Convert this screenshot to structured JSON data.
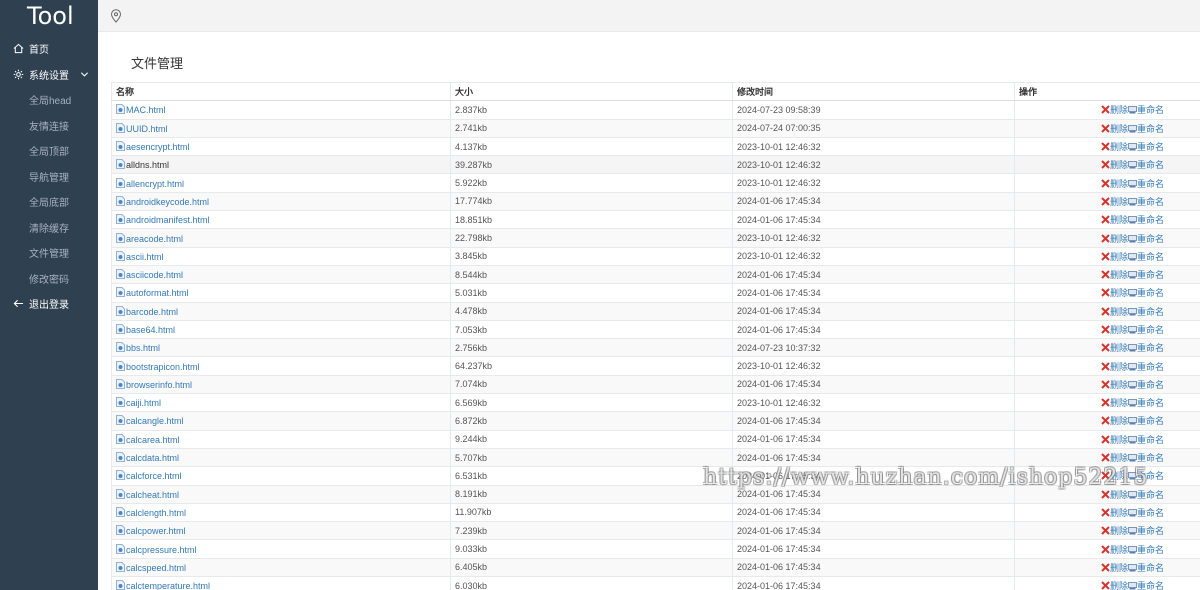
{
  "app": {
    "logo": "Tool"
  },
  "sidebar": {
    "home": "首页",
    "system_settings": "系统设置",
    "sub_items": [
      "全局head",
      "友情连接",
      "全局顶部",
      "导航管理",
      "全局底部",
      "清除缓存",
      "文件管理",
      "修改密码"
    ],
    "logout": "退出登录"
  },
  "page": {
    "title": "文件管理"
  },
  "table": {
    "headers": {
      "name": "名称",
      "size": "大小",
      "modified": "修改时间",
      "actions": "操作"
    },
    "rows": [
      {
        "name": "MAC.html",
        "size": "2.837kb",
        "modified": "2024-07-23 09:58:39"
      },
      {
        "name": "UUID.html",
        "size": "2.741kb",
        "modified": "2024-07-24 07:00:35"
      },
      {
        "name": "aesencrypt.html",
        "size": "4.137kb",
        "modified": "2023-10-01 12:46:32"
      },
      {
        "name": "alldns.html",
        "size": "39.287kb",
        "modified": "2023-10-01 12:46:32"
      },
      {
        "name": "allencrypt.html",
        "size": "5.922kb",
        "modified": "2023-10-01 12:46:32"
      },
      {
        "name": "androidkeycode.html",
        "size": "17.774kb",
        "modified": "2024-01-06 17:45:34"
      },
      {
        "name": "androidmanifest.html",
        "size": "18.851kb",
        "modified": "2024-01-06 17:45:34"
      },
      {
        "name": "areacode.html",
        "size": "22.798kb",
        "modified": "2023-10-01 12:46:32"
      },
      {
        "name": "ascii.html",
        "size": "3.845kb",
        "modified": "2023-10-01 12:46:32"
      },
      {
        "name": "asciicode.html",
        "size": "8.544kb",
        "modified": "2024-01-06 17:45:34"
      },
      {
        "name": "autoformat.html",
        "size": "5.031kb",
        "modified": "2024-01-06 17:45:34"
      },
      {
        "name": "barcode.html",
        "size": "4.478kb",
        "modified": "2024-01-06 17:45:34"
      },
      {
        "name": "base64.html",
        "size": "7.053kb",
        "modified": "2024-01-06 17:45:34"
      },
      {
        "name": "bbs.html",
        "size": "2.756kb",
        "modified": "2024-07-23 10:37:32"
      },
      {
        "name": "bootstrapicon.html",
        "size": "64.237kb",
        "modified": "2023-10-01 12:46:32"
      },
      {
        "name": "browserinfo.html",
        "size": "7.074kb",
        "modified": "2024-01-06 17:45:34"
      },
      {
        "name": "caiji.html",
        "size": "6.569kb",
        "modified": "2023-10-01 12:46:32"
      },
      {
        "name": "calcangle.html",
        "size": "6.872kb",
        "modified": "2024-01-06 17:45:34"
      },
      {
        "name": "calcarea.html",
        "size": "9.244kb",
        "modified": "2024-01-06 17:45:34"
      },
      {
        "name": "calcdata.html",
        "size": "5.707kb",
        "modified": "2024-01-06 17:45:34"
      },
      {
        "name": "calcforce.html",
        "size": "6.531kb",
        "modified": "2024-01-06 17:45:34"
      },
      {
        "name": "calcheat.html",
        "size": "8.191kb",
        "modified": "2024-01-06 17:45:34"
      },
      {
        "name": "calclength.html",
        "size": "11.907kb",
        "modified": "2024-01-06 17:45:34"
      },
      {
        "name": "calcpower.html",
        "size": "7.239kb",
        "modified": "2024-01-06 17:45:34"
      },
      {
        "name": "calcpressure.html",
        "size": "9.033kb",
        "modified": "2024-01-06 17:45:34"
      },
      {
        "name": "calcspeed.html",
        "size": "6.405kb",
        "modified": "2024-01-06 17:45:34"
      },
      {
        "name": "calctemperature.html",
        "size": "6.030kb",
        "modified": "2024-01-06 17:45:34"
      }
    ],
    "delete_label": "删除",
    "rename_label": "重命名"
  },
  "watermark": "https://www.huzhan.com/ishop52215",
  "icons": {
    "home": "home-icon",
    "settings": "gear-icon",
    "chevron": "chevron-down-icon",
    "logout": "arrow-left-icon",
    "location": "map-pin-icon",
    "file": "html-file-icon",
    "delete": "red-x-icon",
    "rename": "rename-icon"
  },
  "colors": {
    "sidebar": "#2f4050",
    "link": "#337ab7",
    "delete": "#d9342b"
  }
}
